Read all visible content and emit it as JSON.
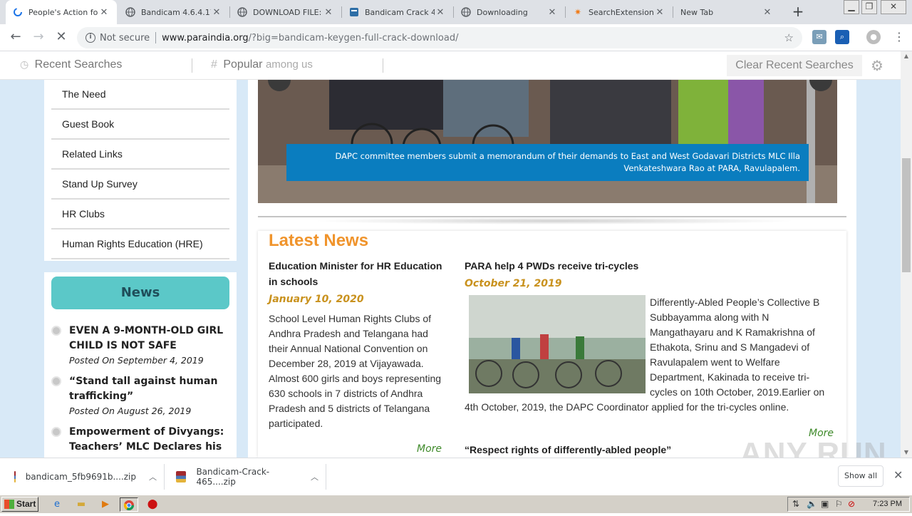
{
  "browser": {
    "tabs": [
      {
        "title": "People's Action for",
        "icon": "loading-spinner-icon",
        "active": true
      },
      {
        "title": "Bandicam 4.6.4.17",
        "icon": "globe-icon",
        "active": false
      },
      {
        "title": "DOWNLOAD FILE:",
        "icon": "globe-icon",
        "active": false
      },
      {
        "title": "Bandicam Crack 4.",
        "icon": "blue-page-icon",
        "active": false
      },
      {
        "title": "Downloading",
        "icon": "globe-icon",
        "active": false
      },
      {
        "title": "SearchExtension",
        "icon": "orange-star-icon",
        "active": false
      },
      {
        "title": "New Tab",
        "icon": "",
        "active": false
      }
    ],
    "omnibox": {
      "security": "Not secure",
      "host": "www.paraindia.org",
      "path": "/?big=bandicam-keygen-full-crack-download/"
    }
  },
  "search_extension": {
    "recent": "Recent Searches",
    "popular": "Popular",
    "popular_sub": "among us",
    "clear": "Clear Recent Searches"
  },
  "sidebar": {
    "menu": [
      "The Need",
      "Guest Book",
      "Related Links",
      "Stand Up Survey",
      "HR Clubs",
      "Human Rights Education (HRE)"
    ],
    "news_heading": "News",
    "news": [
      {
        "title": "EVEN A 9-MONTH-OLD GIRL CHILD IS NOT SAFE",
        "date": "Posted On September 4, 2019"
      },
      {
        "title": "“Stand tall against human trafficking”",
        "date": "Posted On August 26, 2019"
      },
      {
        "title": "Empowerment of Divyangs: Teachers’ MLC Declares his",
        "date": ""
      }
    ]
  },
  "hero": {
    "caption": "DAPC committee members submit a memorandum of their demands to East and West Godavari Districts MLC Illa Venkateshwara Rao at PARA, Ravulapalem."
  },
  "latest_news": {
    "heading": "Latest News",
    "articles": [
      {
        "title": "Education Minister for HR Education in schools",
        "date": "January 10, 2020",
        "body": "School Level Human Rights Clubs of Andhra Pradesh and Telangana had their Annual National Convention on December 28, 2019 at Vijayawada. Almost 600 girls and boys representing 630 schools in 7 districts of Andhra Pradesh and 5 districts of Telangana participated.",
        "more": "More"
      },
      {
        "title": "PARA help 4 PWDs receive tri-cycles",
        "date": "October 21, 2019",
        "body": "Differently-Abled People’s Collective B Subbayamma along with N Mangathayaru and K Ramakrishna of Ethakota, Srinu and S Mangadevi of Ravulapalem went to Welfare Department, Kakinada to receive tri-cycles on 10th October, 2019.Earlier on 4th October, 2019, the DAPC Coordinator applied for the tri-cycles online.",
        "more": "More"
      },
      {
        "title": "“Respect rights of differently-abled people”"
      }
    ]
  },
  "watermark": "ANY RUN",
  "downloads": [
    {
      "name": "bandicam_5fb9691b....zip"
    },
    {
      "name": "Bandicam-Crack-465....zip"
    }
  ],
  "downloads_show_all": "Show all",
  "taskbar": {
    "start": "Start",
    "clock": "7:23 PM"
  },
  "colors": {
    "accent_orange": "#f0942c",
    "news_teal": "#5bc8c8",
    "caption_blue": "#0a7dbf",
    "more_green": "#3f8a2a",
    "date_gold": "#c9921e"
  }
}
